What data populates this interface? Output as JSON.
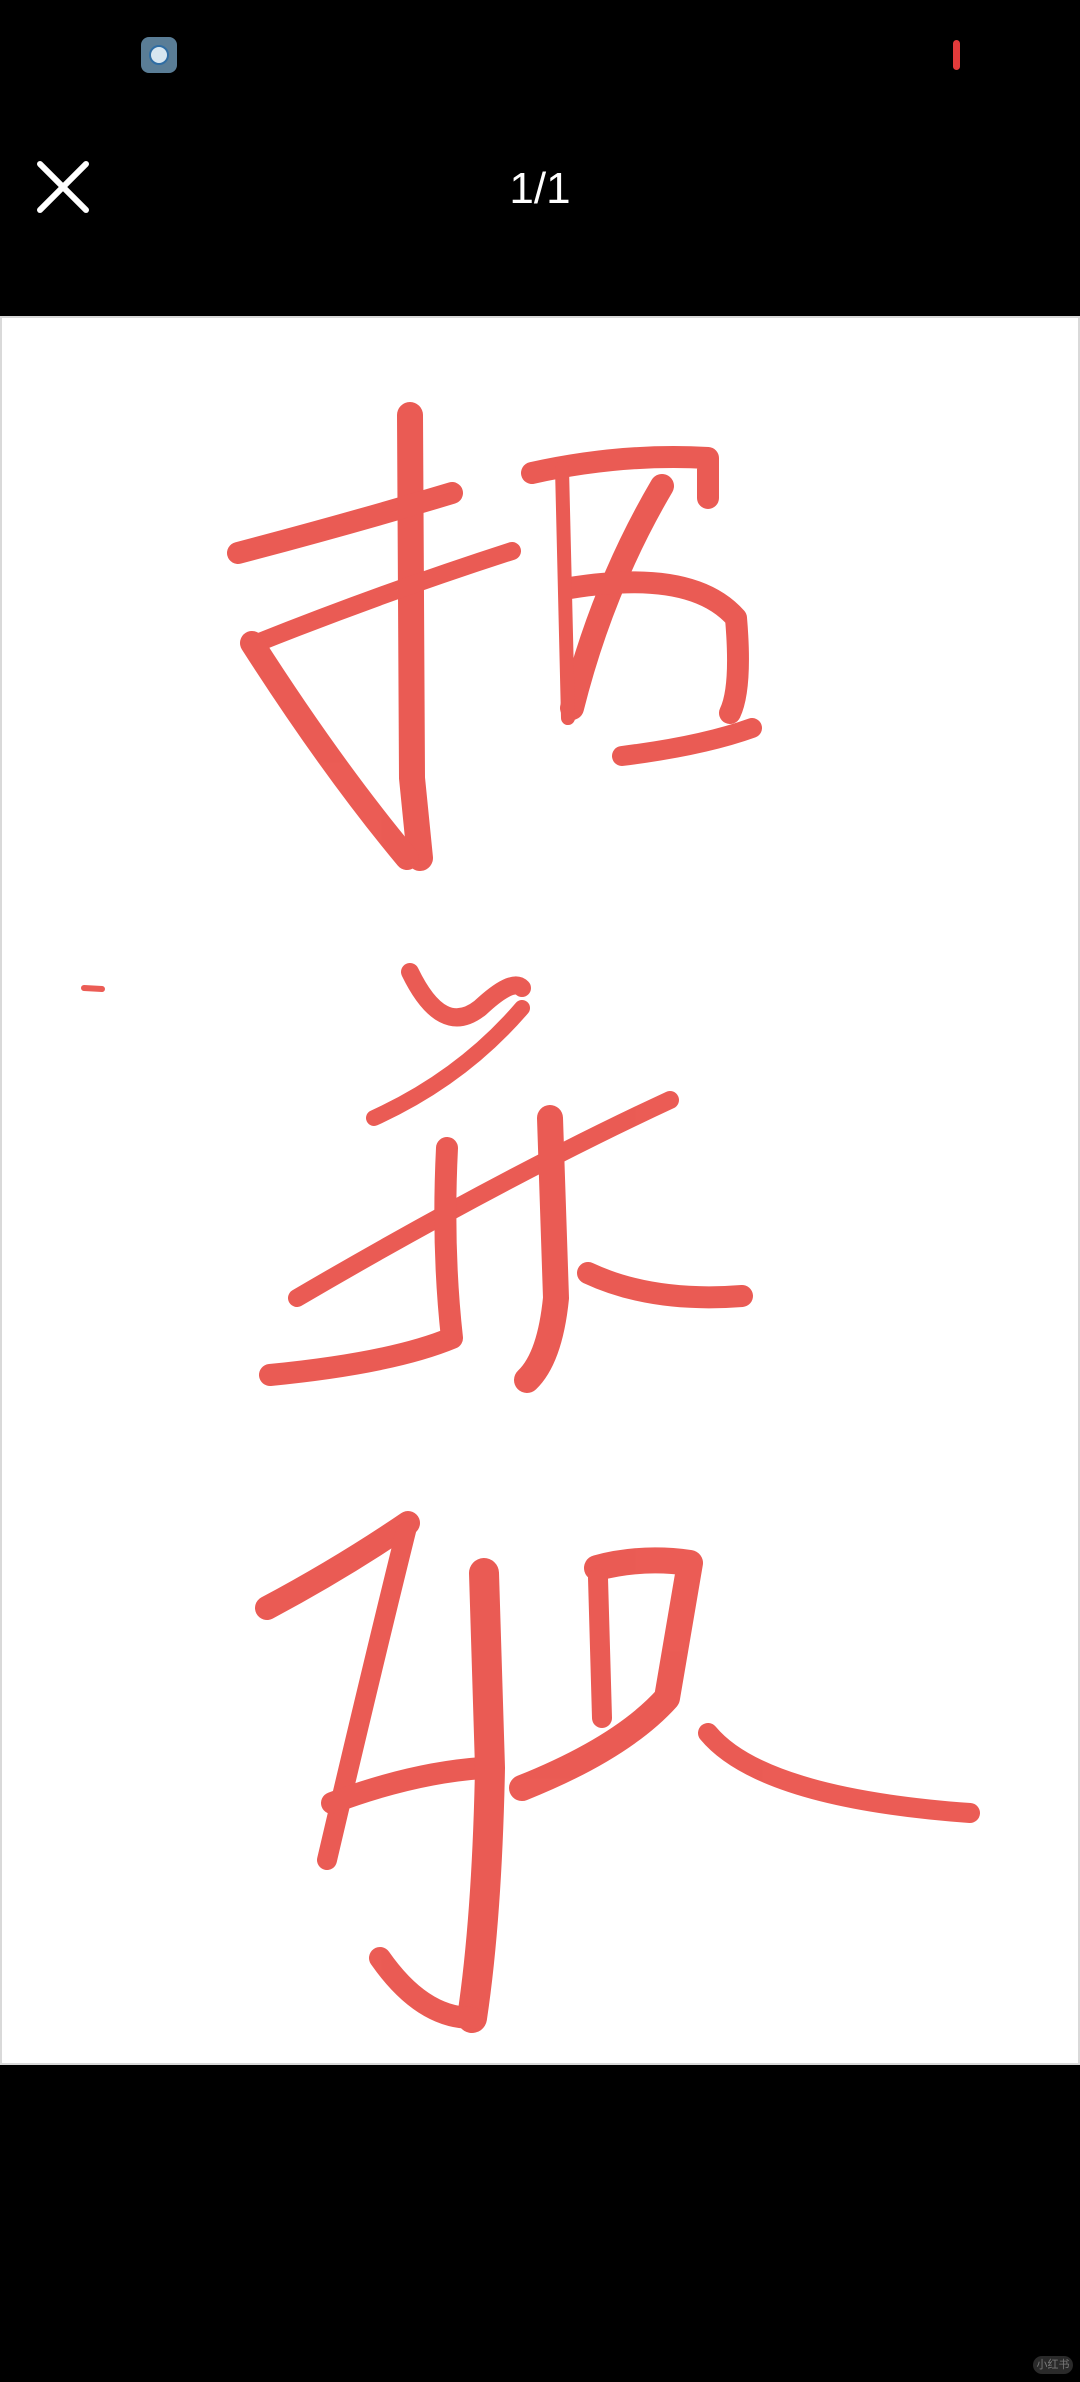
{
  "status_bar": {
    "notification_icon": "app-notification-icon",
    "battery_icon": "battery-low-icon",
    "battery_color": "#e23b3b"
  },
  "viewer": {
    "close_icon": "close-icon",
    "page_counter": "1/1"
  },
  "image": {
    "description_icon": "handwritten-red-brush-strokes",
    "stroke_color": "#e8403a",
    "background": "#ffffff"
  },
  "watermark": {
    "text": "小红书"
  }
}
